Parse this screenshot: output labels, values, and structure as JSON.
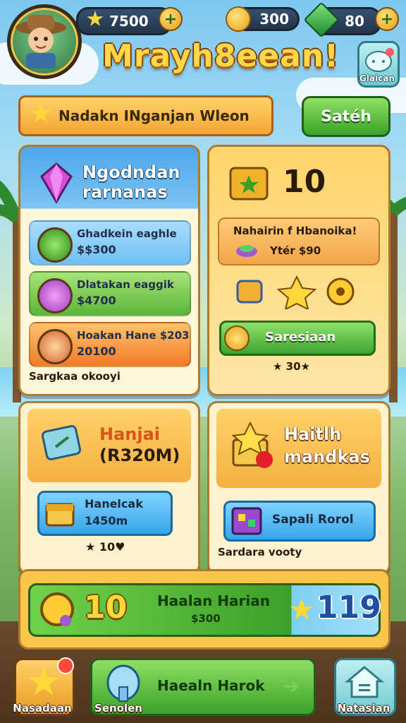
{
  "hud": {
    "coins": "7500",
    "currency_a": "300",
    "currency_b": "80",
    "plus_symbol": "+"
  },
  "game_title": "Mrayh8eean!",
  "corner_button": {
    "label": "Glaican"
  },
  "search": {
    "text": "Nadakn INganjan Wleon",
    "button": "Satéh"
  },
  "panel_offers": {
    "title_line1": "Ngodndan",
    "title_line2": "rarnanas",
    "offers": [
      {
        "name": "Ghadkein eaghle",
        "price": "$$300"
      },
      {
        "name": "Dlatakan eaggik",
        "price": "$4700"
      },
      {
        "name": "Hoakan Hane $203",
        "price": "20100"
      }
    ],
    "footer": "Sargkaa okooyi"
  },
  "panel_reward": {
    "count": "10",
    "banner": "Nahairin f Hbanoika!",
    "banner_sub": "Ytér $90",
    "button": "Saresiaan",
    "footer": "★ 30★"
  },
  "panel_left_bottom": {
    "title_line1": "Hanjai",
    "title_line2": "(R320M)",
    "card_line1": "Hanelcak",
    "card_line2": "1450m",
    "footer": "★ 10♥"
  },
  "panel_right_bottom": {
    "title_line1": "Haitlh",
    "title_line2": "mandkas",
    "button": "Sapali Rorol",
    "footer": "Sardara vooty"
  },
  "daily_banner": {
    "left_count": "10",
    "title": "Haalan Harian",
    "sub": "$300",
    "right_count": "119"
  },
  "nav": {
    "left_label": "Nasadaan",
    "center_label": "Haealn Harok",
    "center_sub": "Senolen",
    "right_label": "Natasian"
  },
  "colors": {
    "accent_gold": "#ffd83a",
    "green": "#3ea42e",
    "blue": "#37a5e8",
    "orange": "#f5a532"
  }
}
